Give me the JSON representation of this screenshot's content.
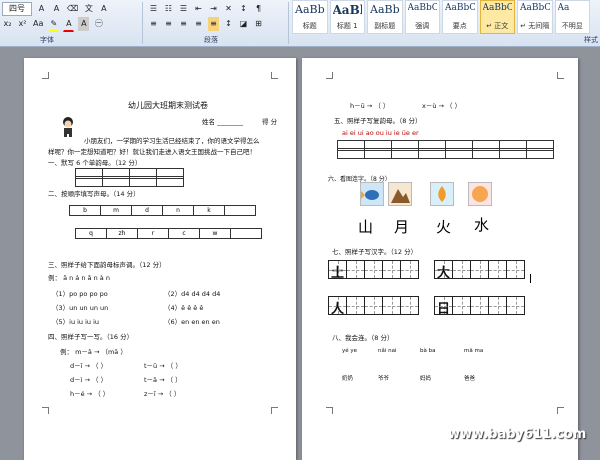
{
  "ribbon": {
    "font_size": "四号",
    "font_group_label": "字体",
    "paragraph_group_label": "段落",
    "styles_group_label": "样式",
    "styles": [
      {
        "sample": "AaBbC",
        "name": "标题"
      },
      {
        "sample": "AaBl",
        "name": "标题 1"
      },
      {
        "sample": "AaBb(",
        "name": "副标题"
      },
      {
        "sample": "AaBbCcDi",
        "name": "强调"
      },
      {
        "sample": "AaBbCcD",
        "name": "要点"
      },
      {
        "sample": "AaBbCcDi",
        "name": "↵ 正文"
      },
      {
        "sample": "AaBbCcDi",
        "name": "↵ 无间隔"
      },
      {
        "sample": "Aa",
        "name": "不明显"
      }
    ]
  },
  "left_page": {
    "title": "幼儿园大班期末测试卷",
    "name_label": "姓名 ________",
    "score_label": "得 分",
    "intro1": "小朋友们，一学期的学习生活已经结束了，你的语文学得怎么",
    "intro2": "样呢？你一定想知道吧？好！就让我们走进入语文王国挑战一下自己吧！",
    "q1": "一、默写 6 个单韵母。（12 分）",
    "q2": "二、按顺序填写声母。（14 分）",
    "q2_row1": [
      "b",
      "m",
      "d",
      "n",
      "k",
      ""
    ],
    "q2_row2": [
      "q",
      "zh",
      "r",
      "c",
      "w",
      ""
    ],
    "q3": "三、照样子给下面韵母标声调。（12 分）",
    "q3_example": "例： ā n   á n   ǎ n   à n",
    "q3_lines": [
      "（1）po   po   po   po",
      "（2）d4   d4   d4   d4",
      "（3）un   un   un   un",
      "（4）ê   ê   ê   ê",
      "（5）iu   iu   iu   iu",
      "（6）en   en   en   en"
    ],
    "q4": "四、照样子写一写。（16 分）",
    "q4_example": "例： m－ā → （mā ）",
    "q4_lines": [
      "d－ī →  （        ）",
      "t－ū →  （        ）",
      "d－ì →  （        ）",
      "t－ā →  （        ）",
      "h－é →  （        ）",
      "z－ī →  （        ）"
    ]
  },
  "right_page": {
    "top_lines": [
      "h－ū →  （        ）",
      "x－ù →  （        ）"
    ],
    "q5": "五、照样子写复韵母。（8 分）",
    "q5_items": "ai   ei   ui   ao   ou   iu   ie   üe   er",
    "q6": "六、看图连字。（8 分）",
    "q6_chars": [
      "山",
      "月",
      "火",
      "水"
    ],
    "q7": "七、照样子写汉字。（12 分）",
    "q7_chars": [
      "土",
      "大",
      "人",
      "日"
    ],
    "q8": "八、我会连。（8 分）",
    "q8_pinyin": [
      "yé ye",
      "nǎi nai",
      "bà ba",
      "mā ma"
    ],
    "q8_words": [
      "奶奶",
      "爷爷",
      "妈妈",
      "爸爸"
    ]
  },
  "watermark": "www.baby611.com"
}
